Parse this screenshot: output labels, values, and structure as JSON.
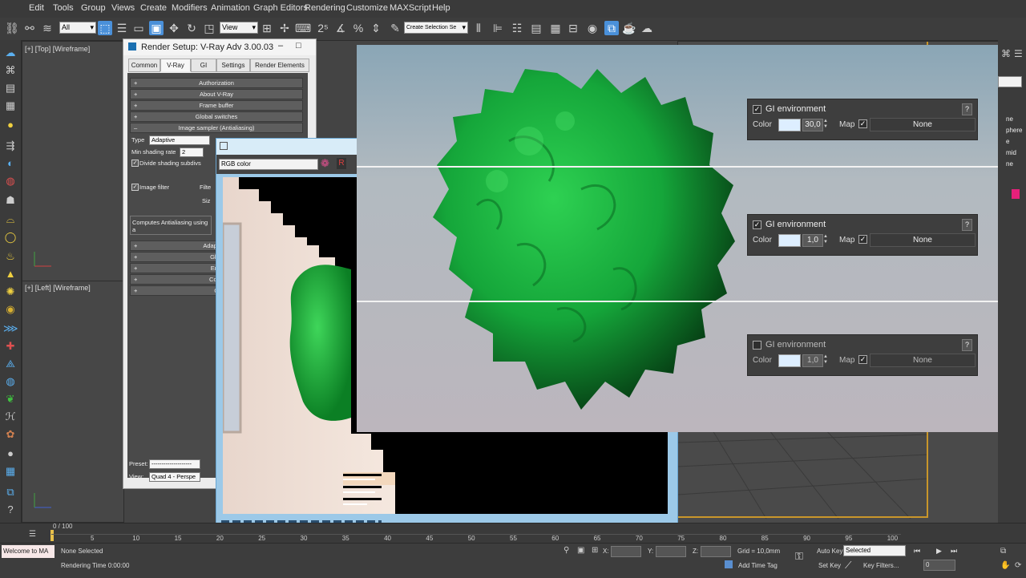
{
  "menu": [
    "Edit",
    "Tools",
    "Group",
    "Views",
    "Create",
    "Modifiers",
    "Animation",
    "Graph Editors",
    "Rendering",
    "Customize",
    "MAXScript",
    "Help"
  ],
  "toolbar": {
    "filter_value": "All",
    "view_value": "View",
    "selection_set_placeholder": "Create Selection Se"
  },
  "viewports": {
    "top_label": "[+] [Top] [Wireframe]",
    "left_label": "[+] [Left] [Wireframe]"
  },
  "render_setup": {
    "title": "Render Setup: V-Ray Adv 3.00.03",
    "tabs": [
      "Common",
      "V-Ray",
      "GI",
      "Settings",
      "Render Elements"
    ],
    "active_tab": "V-Ray",
    "rollouts_top": [
      "Authorization",
      "About V-Ray",
      "Frame buffer",
      "Global switches",
      "Image sampler (Antialiasing)"
    ],
    "type_label": "Type",
    "type_value": "Adaptive",
    "min_shading_label": "Min shading rate",
    "min_shading_value": "2",
    "divide_label": "Divide shading subdivs",
    "image_filter_label": "Image filter",
    "filter_label_partial": "Filte",
    "size_label_partial": "Siz",
    "description": "Computes Antialiasing using a",
    "rollouts_bottom": [
      "Adaptive I",
      "Glob",
      "Envi",
      "Color",
      "C"
    ],
    "preset_label": "Preset:",
    "preset_value": "--------------------",
    "view_label": "View:",
    "view_value": "Quad 4 - Perspe"
  },
  "frame_buffer": {
    "channel": "RGB color"
  },
  "gi_panels": [
    {
      "label": "GI environment",
      "checked": true,
      "color_label": "Color",
      "value": "30,0",
      "map_label": "Map",
      "map_checked": true,
      "map_value": "None"
    },
    {
      "label": "GI environment",
      "checked": true,
      "color_label": "Color",
      "value": "1,0",
      "map_label": "Map",
      "map_checked": true,
      "map_value": "None"
    },
    {
      "label": "GI environment",
      "checked": false,
      "color_label": "Color",
      "value": "1,0",
      "map_label": "Map",
      "map_checked": true,
      "map_value": "None"
    }
  ],
  "right_panel": {
    "items": [
      "ne",
      "phere",
      "e",
      "mid",
      "ne"
    ]
  },
  "timeline": {
    "frame": "0 / 100",
    "ticks": [
      "5",
      "10",
      "15",
      "20",
      "25",
      "30",
      "35",
      "40",
      "45",
      "50",
      "55",
      "60",
      "65",
      "70",
      "75",
      "80",
      "85",
      "90",
      "95",
      "100"
    ]
  },
  "status": {
    "maxscript": "Welcome to MA",
    "none_selected": "None Selected",
    "rendering_time": "Rendering Time  0:00:00",
    "x_label": "X:",
    "y_label": "Y:",
    "z_label": "Z:",
    "grid": "Grid = 10,0mm",
    "add_time_tag": "Add Time Tag",
    "auto_key": "Auto Key",
    "selected": "Selected",
    "set_key": "Set Key",
    "key_filters": "Key Filters...",
    "frame_value": "0"
  },
  "colors": {
    "blob_green": "#1fa83e",
    "swatch": "#ddeeff",
    "accent_blue": "#4a90d9"
  }
}
